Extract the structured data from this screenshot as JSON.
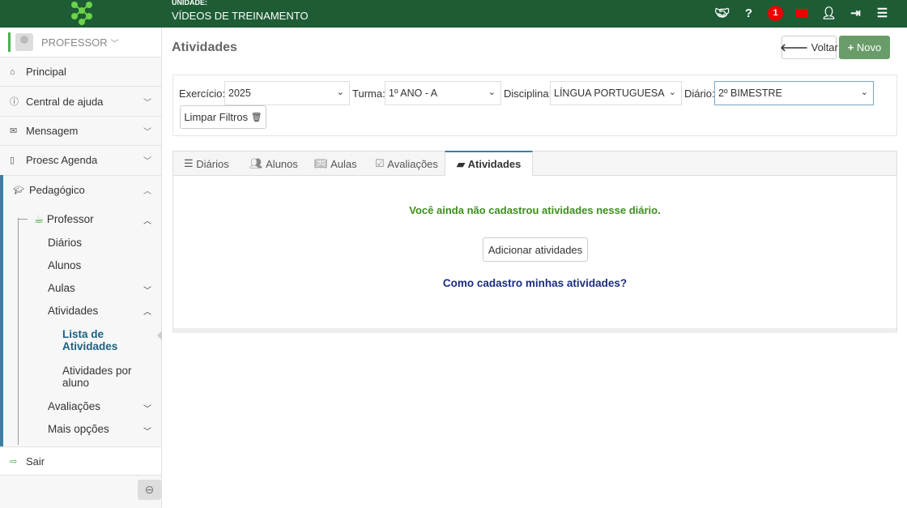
{
  "header": {
    "unit_label": "UNIDADE:",
    "unit_name": "VÍDEOS DE TREINAMENTO",
    "notification_count": "1",
    "help": "?"
  },
  "sidebar": {
    "user": "PROFESSOR",
    "items": [
      {
        "label": "Principal"
      },
      {
        "label": "Central de ajuda"
      },
      {
        "label": "Mensagem"
      },
      {
        "label": "Proesc Agenda"
      },
      {
        "label": "Pedagógico"
      }
    ],
    "professor": "Professor",
    "sub": [
      "Diários",
      "Alunos",
      "Aulas",
      "Atividades",
      "Avaliações",
      "Mais opções"
    ],
    "atividades_sub": [
      "Lista de Atividades",
      "Atividades por aluno"
    ],
    "logout": "Sair"
  },
  "page": {
    "title": "Atividades",
    "back": "Voltar",
    "new": "Novo"
  },
  "filters": {
    "exercicio_label": "Exercício:",
    "exercicio": "2025",
    "turma_label": "Turma:",
    "turma": "1º ANO - A",
    "disciplina_label": "Disciplina:",
    "disciplina": "LÍNGUA PORTUGUESA",
    "diario_label": "Diário:",
    "diario": "2º BIMESTRE",
    "clear": "Limpar Filtros"
  },
  "tabs": [
    "Diários",
    "Alunos",
    "Aulas",
    "Avaliações",
    "Atividades"
  ],
  "content": {
    "empty": "Você ainda não cadastrou atividades nesse diário.",
    "add": "Adicionar atividades",
    "help": "Como cadastro minhas atividades?"
  },
  "colors": {
    "header": "#1d5c34",
    "accent": "#3d7fa3",
    "success": "#3c8f1e",
    "link": "#1a2e80",
    "new_btn": "#6a9c6a"
  }
}
